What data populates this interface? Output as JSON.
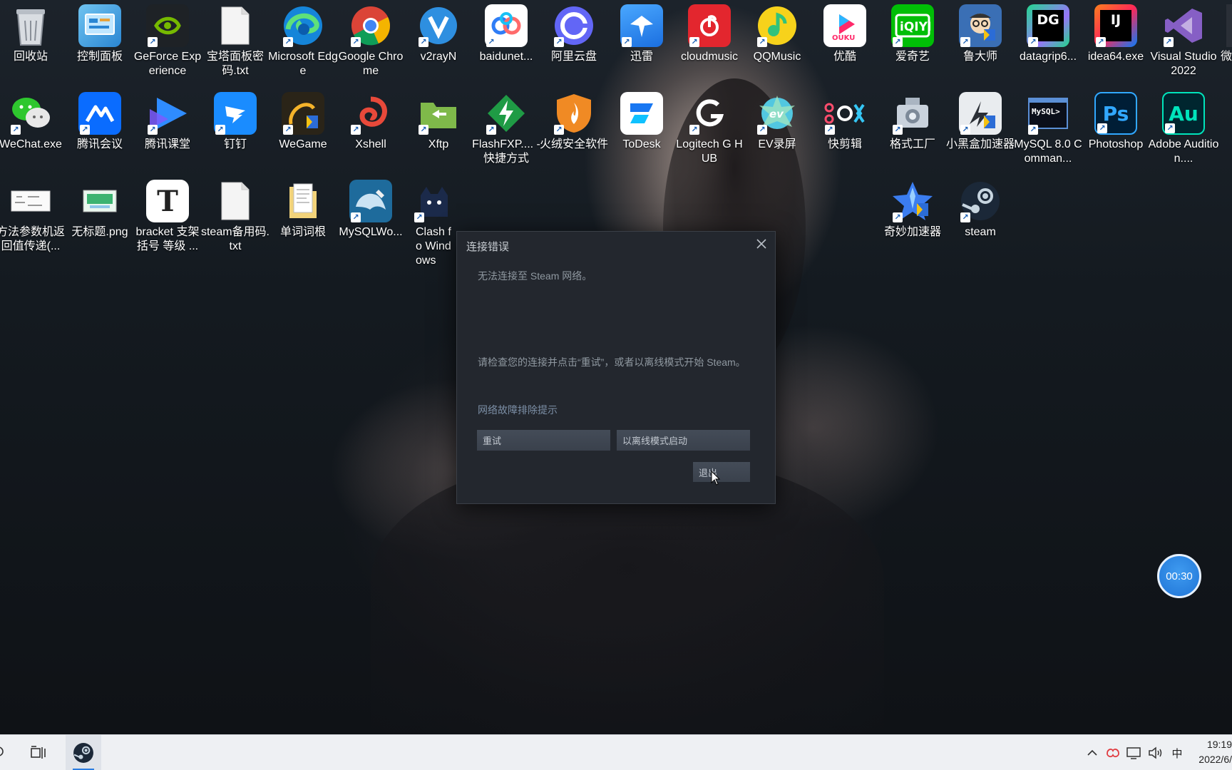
{
  "desktop": {
    "row1": [
      {
        "label": "回收站",
        "icon": "recycle-bin-icon"
      },
      {
        "label": "控制面板",
        "icon": "control-panel-icon"
      },
      {
        "label": "GeForce Experience",
        "icon": "nvidia-icon"
      },
      {
        "label": "宝塔面板密码.txt",
        "icon": "text-file-icon"
      },
      {
        "label": "Microsoft Edge",
        "icon": "edge-icon"
      },
      {
        "label": "Google Chrome",
        "icon": "chrome-icon"
      },
      {
        "label": "v2rayN",
        "icon": "v2rayn-icon"
      },
      {
        "label": "baidunet...",
        "icon": "baidu-netdisk-icon"
      },
      {
        "label": "阿里云盘",
        "icon": "aliyun-drive-icon"
      },
      {
        "label": "迅雷",
        "icon": "thunder-icon"
      },
      {
        "label": "cloudmusic",
        "icon": "netease-music-icon"
      },
      {
        "label": "QQMusic",
        "icon": "qqmusic-icon"
      },
      {
        "label": "优酷",
        "icon": "youku-icon"
      },
      {
        "label": "爱奇艺",
        "icon": "iqiyi-icon"
      },
      {
        "label": "鲁大师",
        "icon": "ludashi-icon"
      },
      {
        "label": "datagrip6...",
        "icon": "datagrip-icon"
      },
      {
        "label": "idea64.exe",
        "icon": "intellij-icon"
      },
      {
        "label": "Visual Studio 2022",
        "icon": "visual-studio-icon"
      },
      {
        "label": "微",
        "icon": "wechat-partial-icon"
      }
    ],
    "row2": [
      {
        "label": "WeChat.exe",
        "icon": "wechat-icon"
      },
      {
        "label": "腾讯会议",
        "icon": "tencent-meeting-icon"
      },
      {
        "label": "腾讯课堂",
        "icon": "tencent-classroom-icon"
      },
      {
        "label": "钉钉",
        "icon": "dingtalk-icon"
      },
      {
        "label": "WeGame",
        "icon": "wegame-icon"
      },
      {
        "label": "Xshell",
        "icon": "xshell-icon"
      },
      {
        "label": "Xftp",
        "icon": "xftp-icon"
      },
      {
        "label": "FlashFXP.... - 快捷方式",
        "icon": "flashfxp-icon"
      },
      {
        "label": "火绒安全软件",
        "icon": "huorong-icon"
      },
      {
        "label": "ToDesk",
        "icon": "todesk-icon"
      },
      {
        "label": "Logitech G HUB",
        "icon": "logitech-icon"
      },
      {
        "label": "EV录屏",
        "icon": "ev-recorder-icon"
      },
      {
        "label": "快剪辑",
        "icon": "kuaijianji-icon"
      },
      {
        "label": "格式工厂",
        "icon": "format-factory-icon"
      },
      {
        "label": "小黑盒加速器",
        "icon": "xiaoheihe-icon"
      },
      {
        "label": "MySQL 8.0 Comman...",
        "icon": "mysql-cli-icon"
      },
      {
        "label": "Photoshop",
        "icon": "photoshop-icon"
      },
      {
        "label": "Adobe Audition....",
        "icon": "audition-icon"
      }
    ],
    "row3": [
      {
        "label": "方法参数机返回值传递(...",
        "icon": "image-file-icon"
      },
      {
        "label": "无标题.png",
        "icon": "png-file-icon"
      },
      {
        "label": "bracket 支架 括号 等级 ...",
        "icon": "typora-icon"
      },
      {
        "label": "steam备用码.txt",
        "icon": "text-file-icon"
      },
      {
        "label": "单词词根",
        "icon": "folder-doc-icon"
      },
      {
        "label": "MySQLWo...",
        "icon": "mysql-workbench-icon"
      },
      {
        "label": "Clash fo Windows",
        "icon": "clash-icon"
      },
      {
        "label": "奇妙加速器",
        "icon": "qimiao-icon"
      },
      {
        "label": "steam",
        "icon": "steam-icon"
      }
    ]
  },
  "dialog": {
    "title": "连接错误",
    "message": "无法连接至 Steam 网络。",
    "hint": "请检查您的连接并点击“重试”，或者以离线模式开始 Steam。",
    "link": "网络故障排除提示",
    "retry_label": "重试",
    "offline_label": "以离线模式启动",
    "quit_label": "退出"
  },
  "timer": {
    "text": "00:30"
  },
  "taskbar": {
    "ime": "中",
    "time": "19:19",
    "date": "2022/6/"
  }
}
